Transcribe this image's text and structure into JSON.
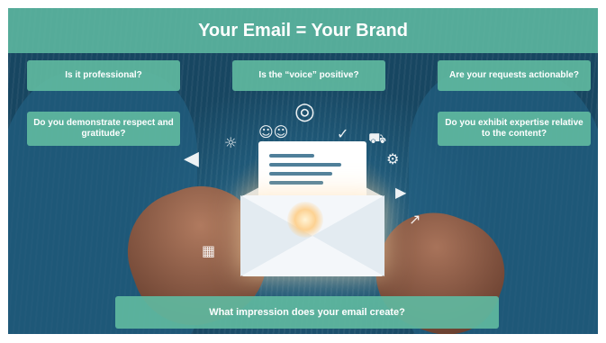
{
  "title": "Your Email = Your Brand",
  "questions": [
    "Is it professional?",
    "Is the “voice” positive?",
    "Are your requests actionable?",
    "Do you demonstrate respect and gratitude?",
    "Do you exhibit expertise relative to the content?"
  ],
  "bottom_question": "What impression does your email create?",
  "colors": {
    "accent": "#5fb9a0",
    "background_photo": "#1f5877",
    "text": "#ffffff"
  },
  "icons": [
    "target-icon",
    "people-icon",
    "thumbs-up-icon",
    "cart-icon",
    "gear-icon",
    "megaphone-icon",
    "lightbulb-icon",
    "play-icon",
    "chart-icon",
    "envelope-icon"
  ]
}
